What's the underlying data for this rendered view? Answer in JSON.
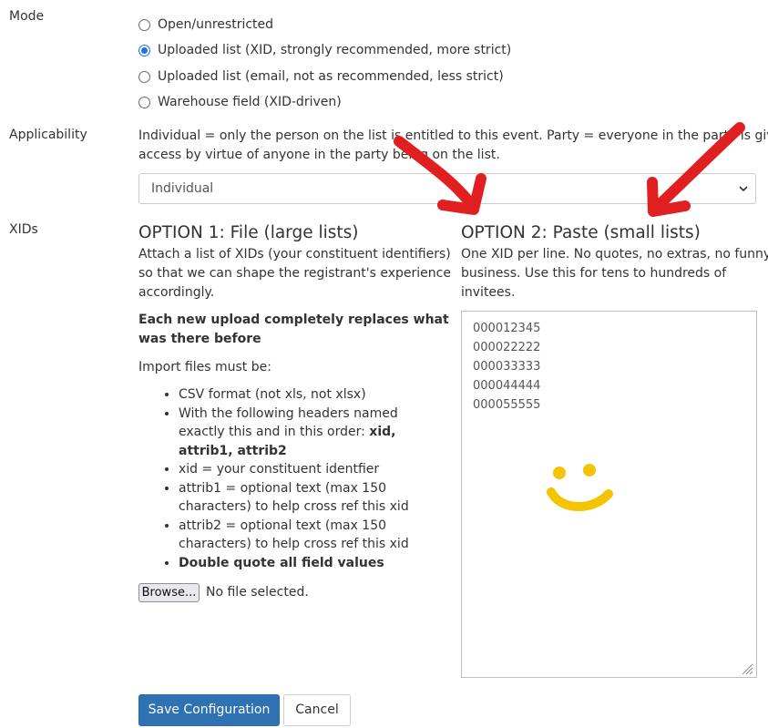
{
  "mode": {
    "label": "Mode",
    "options": [
      {
        "label": "Open/unrestricted",
        "checked": false
      },
      {
        "label": "Uploaded list (XID, strongly recommended, more strict)",
        "checked": true
      },
      {
        "label": "Uploaded list (email, not as recommended, less strict)",
        "checked": false
      },
      {
        "label": "Warehouse field (XID-driven)",
        "checked": false
      }
    ]
  },
  "applicability": {
    "label": "Applicability",
    "help_line1": "Individual = only the person on the list is entitled to this event. Party = everyone in the party is given",
    "help_line2": "access by virtue of anyone in the party being on the list.",
    "selected": "Individual"
  },
  "xids": {
    "label": "XIDs",
    "option1": {
      "title": "OPTION 1: File (large lists)",
      "desc_lines": [
        "Attach a list of XIDs (your constituent identifiers)",
        "so that we can shape the registrant's experience",
        "accordingly."
      ],
      "warning_line1": "Each new upload completely replaces what",
      "warning_line2": "was there before",
      "import_intro": "Import files must be:",
      "requirements": {
        "r1": "CSV format (not xls, not xlsx)",
        "r2_l1": "With the following headers named",
        "r2_l2": "exactly this and in this order: ",
        "r2_bold1": "xid,",
        "r2_bold2": "attrib1, attrib2",
        "r3": "xid = your constituent identfier",
        "r4_l1": "attrib1 = optional text (max 150",
        "r4_l2": "characters) to help cross ref this xid",
        "r5_l1": "attrib2 = optional text (max 150",
        "r5_l2": "characters) to help cross ref this xid",
        "r6": "Double quote all field values"
      },
      "browse_label": "Browse...",
      "file_status": "No file selected."
    },
    "option2": {
      "title": "OPTION 2: Paste (small lists)",
      "desc_lines": [
        "One XID per line. No quotes, no extras, no funny",
        "business. Use this for tens to hundreds of",
        "invitees."
      ],
      "textarea_value": "000012345\n000022222\n000033333\n000044444\n000055555"
    }
  },
  "actions": {
    "save_label": "Save Configuration",
    "cancel_label": "Cancel"
  },
  "colors": {
    "annotation_arrows": "#e02020",
    "smiley": "#f5c400",
    "primary_button": "#2f72b3"
  }
}
